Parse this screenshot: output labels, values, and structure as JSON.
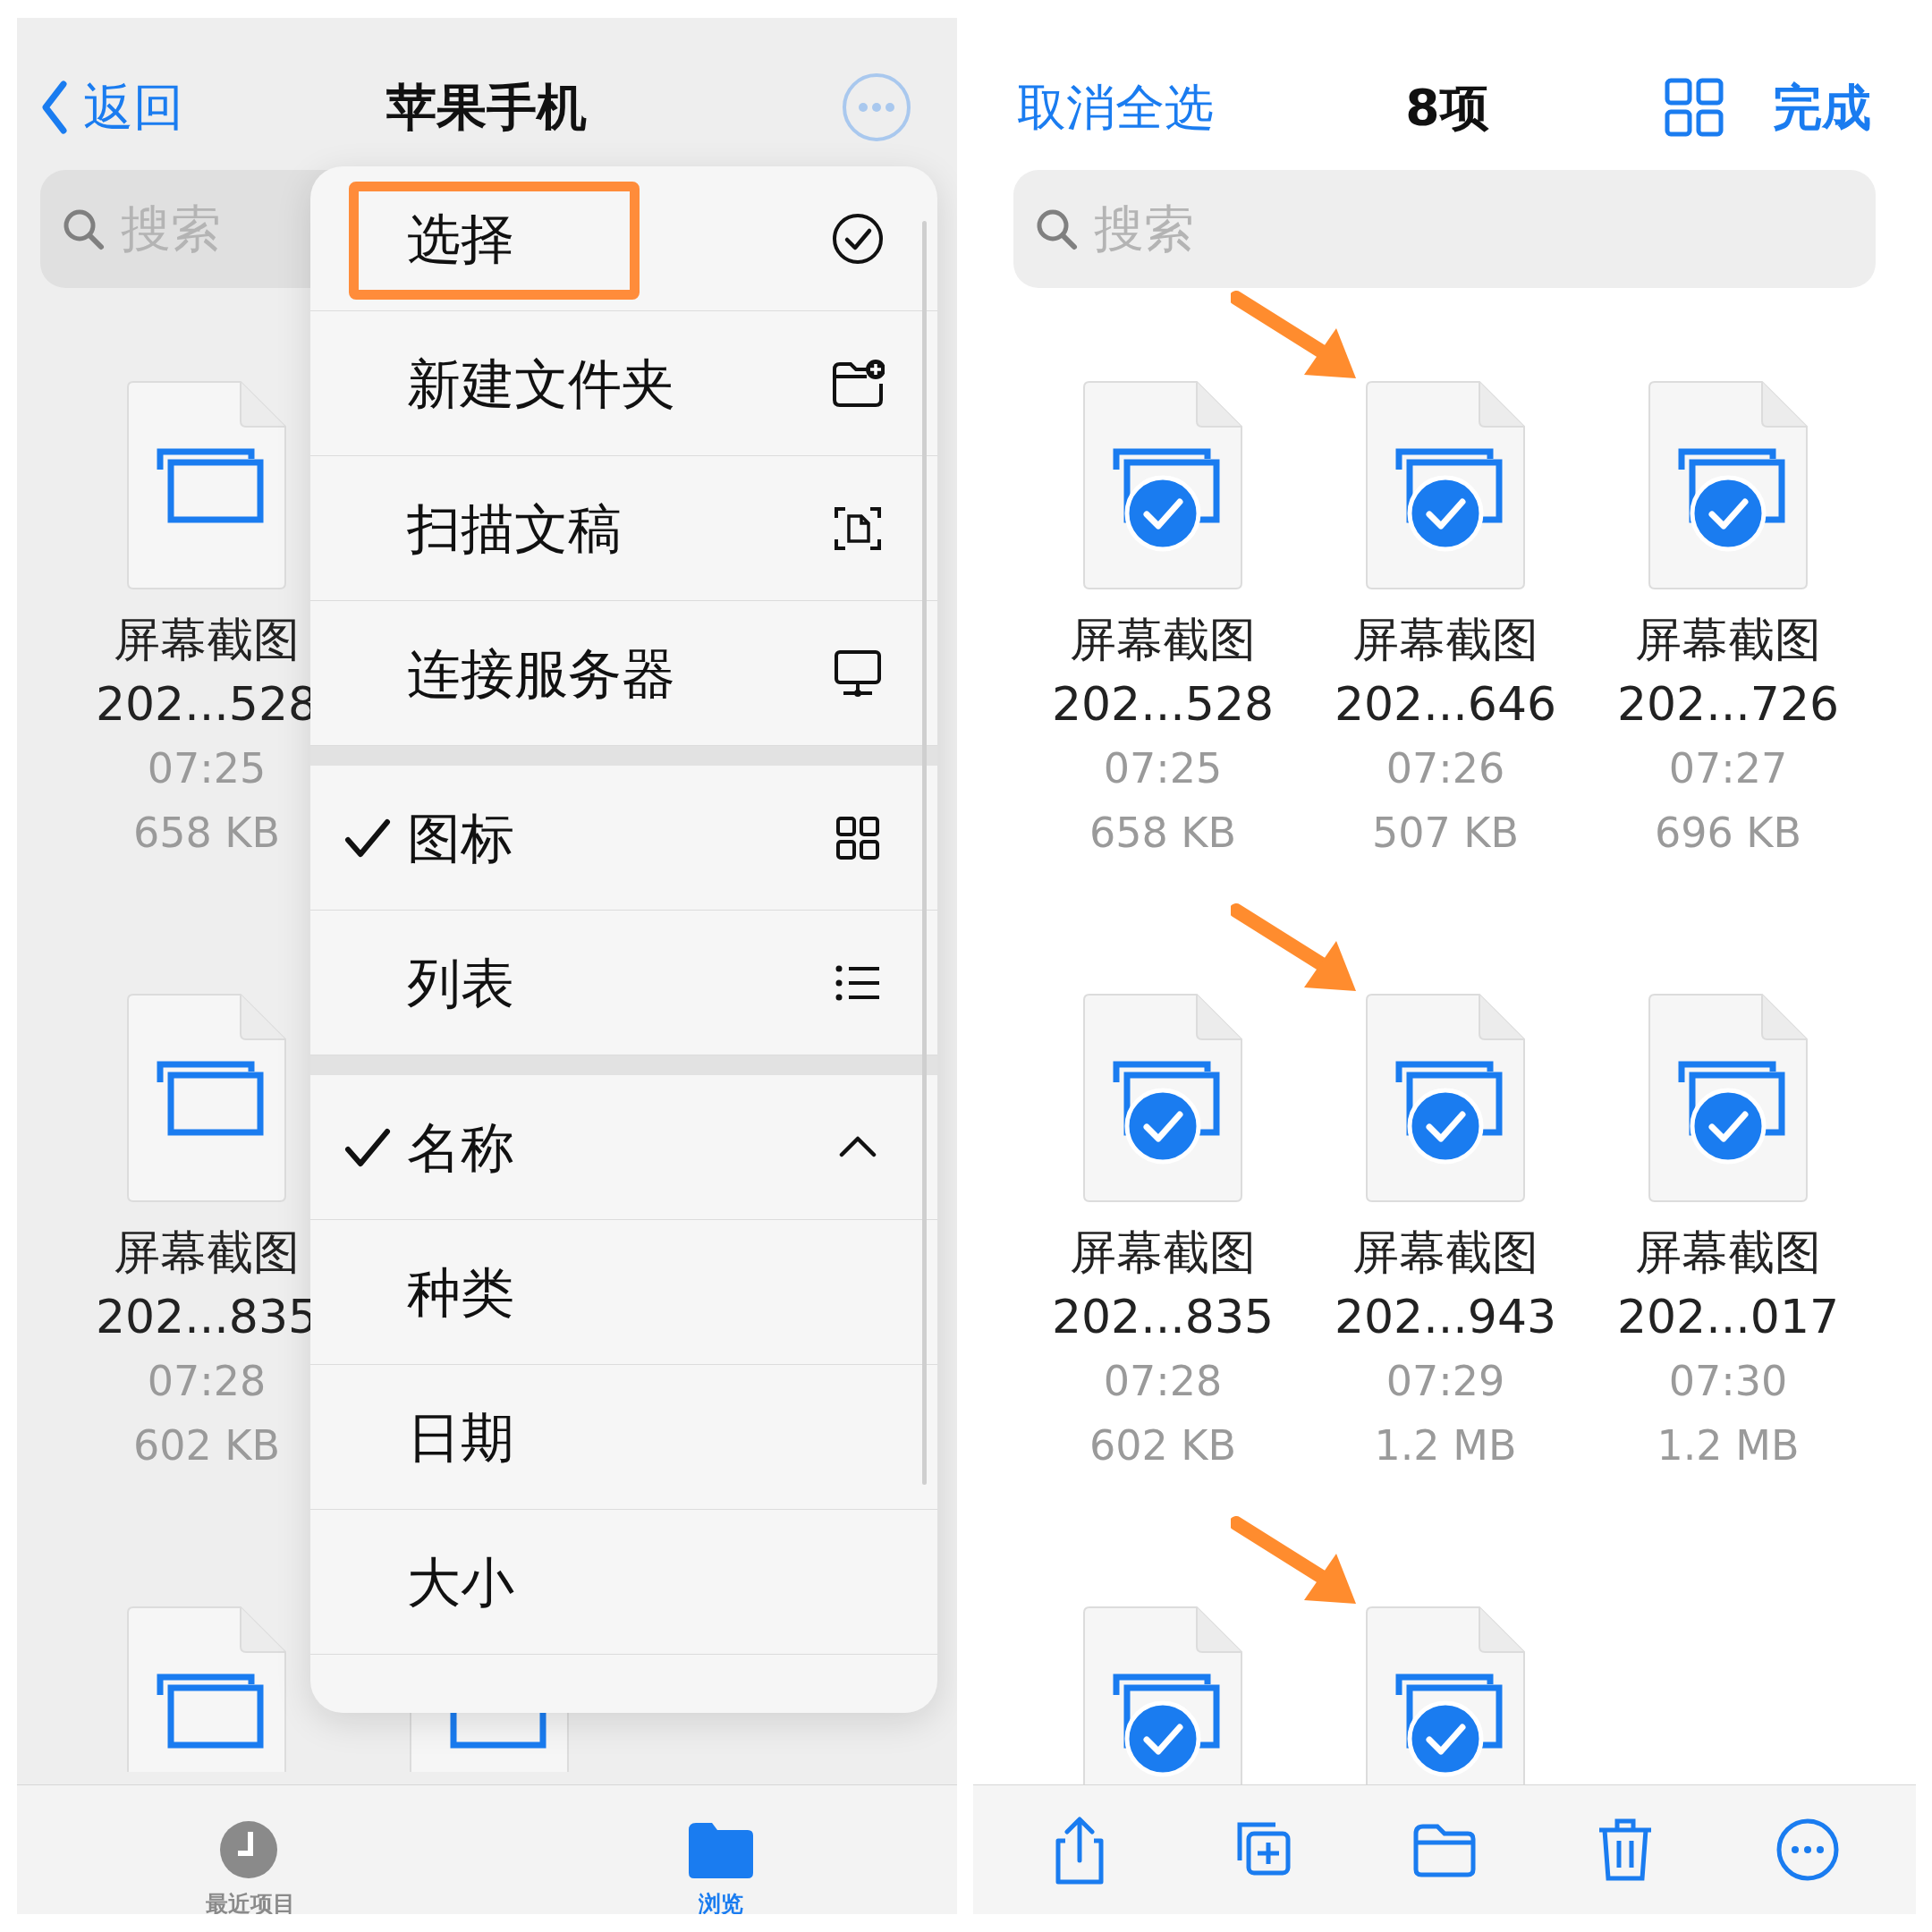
{
  "left": {
    "nav": {
      "back": "返回",
      "title": "苹果手机"
    },
    "search": {
      "placeholder": "搜索"
    },
    "file_rows": [
      {
        "files": [
          {
            "name_lines": [
              "屏幕截图",
              "202...528"
            ],
            "time": "07:25",
            "size": "658 KB"
          }
        ]
      },
      {
        "files": [
          {
            "name_lines": [
              "屏幕截图",
              "202...835"
            ],
            "time": "07:28",
            "size": "602 KB"
          }
        ]
      },
      {
        "files": [
          {
            "kind": "icon_only"
          },
          {
            "kind": "icon_only"
          }
        ]
      }
    ],
    "menu": {
      "sections": [
        {
          "items": [
            {
              "label": "选择",
              "checked": false,
              "highlighted": true
            },
            {
              "label": "新建文件夹",
              "checked": false,
              "highlighted": false
            },
            {
              "label": "扫描文稿",
              "checked": false,
              "highlighted": false
            },
            {
              "label": "连接服务器",
              "checked": false,
              "highlighted": false
            }
          ]
        },
        {
          "items": [
            {
              "label": "图标",
              "checked": true,
              "highlighted": false
            },
            {
              "label": "列表",
              "checked": false,
              "highlighted": false
            }
          ]
        },
        {
          "items": [
            {
              "label": "名称",
              "checked": true,
              "highlighted": false
            },
            {
              "label": "种类",
              "checked": false,
              "highlighted": false
            },
            {
              "label": "日期",
              "checked": false,
              "highlighted": false
            },
            {
              "label": "大小",
              "checked": false,
              "highlighted": false
            }
          ]
        }
      ]
    },
    "tab_bar": [
      {
        "label": "最近项目",
        "selected": false
      },
      {
        "label": "浏览",
        "selected": true
      }
    ]
  },
  "right": {
    "nav": {
      "cancel": "取消全选",
      "count": "8项",
      "done": "完成"
    },
    "search": {
      "placeholder": "搜索"
    },
    "files": [
      {
        "name_lines": [
          "屏幕截图",
          "202...528"
        ],
        "time": "07:25",
        "size": "658 KB",
        "selected": true,
        "marked": false
      },
      {
        "name_lines": [
          "屏幕截图",
          "202...646"
        ],
        "time": "07:26",
        "size": "507 KB",
        "selected": true,
        "marked": true
      },
      {
        "name_lines": [
          "屏幕截图",
          "202...726"
        ],
        "time": "07:27",
        "size": "696 KB",
        "selected": true,
        "marked": false
      },
      {
        "name_lines": [
          "屏幕截图",
          "202...835"
        ],
        "time": "07:28",
        "size": "602 KB",
        "selected": true,
        "marked": false
      },
      {
        "name_lines": [
          "屏幕截图",
          "202...943"
        ],
        "time": "07:29",
        "size": "1.2 MB",
        "selected": true,
        "marked": true
      },
      {
        "name_lines": [
          "屏幕截图",
          "202...017"
        ],
        "time": "07:30",
        "size": "1.2 MB",
        "selected": true,
        "marked": false
      },
      {
        "selected": true,
        "marked": false
      },
      {
        "selected": true,
        "marked": true
      }
    ]
  }
}
